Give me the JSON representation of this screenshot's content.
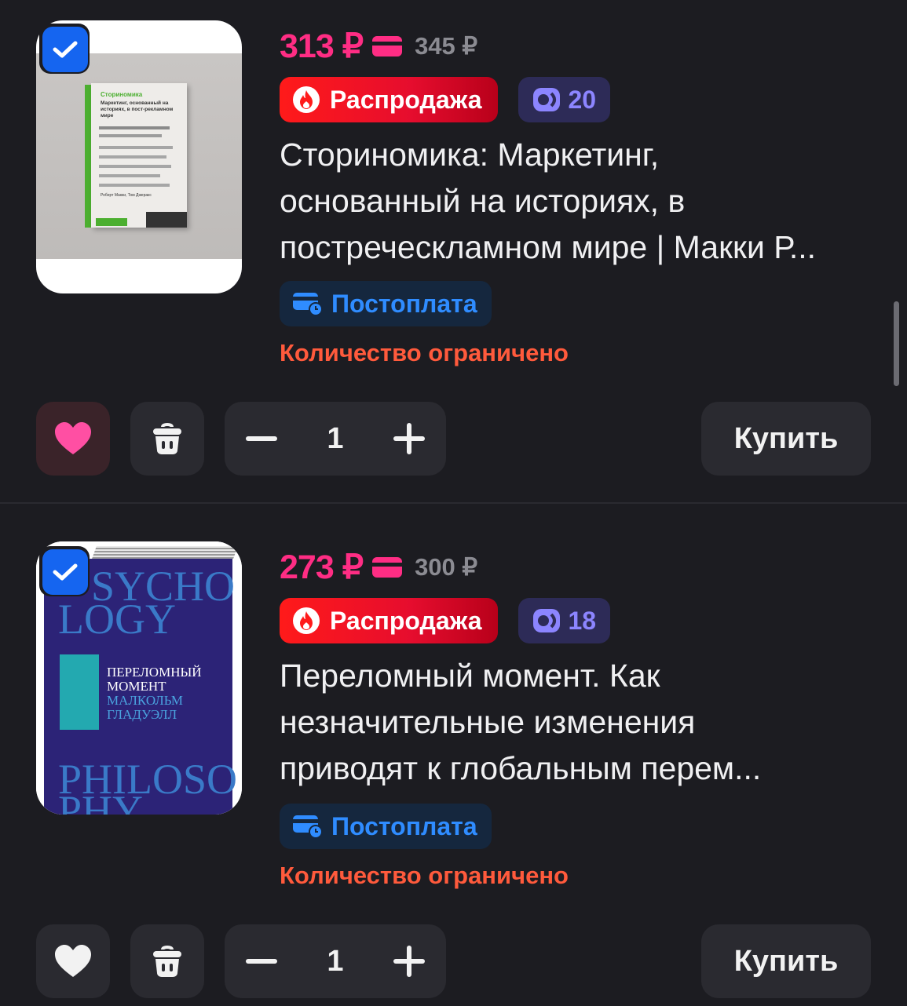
{
  "items": [
    {
      "selected": true,
      "price": "313 ₽",
      "old_price": "345 ₽",
      "sale_label": "Распродажа",
      "points": "20",
      "title_lines": [
        "Сториномика: Маркетинг,",
        "основанный на историях, в",
        "постреческламном мире | Макки Р..."
      ],
      "postpay_label": "Постоплата",
      "limited_label": "Количество ограничено",
      "favorite": true,
      "quantity": "1",
      "buy_label": "Купить",
      "cover": {
        "title": "Сториномика",
        "subtitle": "Маркетинг, основанный на историях, в пост-рекламном мире",
        "authors": "Роберт Макки, Том Джеракс"
      }
    },
    {
      "selected": true,
      "price": "273 ₽",
      "old_price": "300 ₽",
      "sale_label": "Распродажа",
      "points": "18",
      "title_lines": [
        "Переломный момент. Как",
        "незначительные изменения",
        "приводят к глобальным перем..."
      ],
      "postpay_label": "Постоплата",
      "limited_label": "Количество ограничено",
      "favorite": false,
      "quantity": "1",
      "buy_label": "Купить",
      "cover": {
        "word_top_1": "SYCHO",
        "word_top_2": "LOGY",
        "title_1": "ПЕРЕЛОМНЫЙ",
        "title_2": "МОМЕНТ",
        "author_1": "МАЛКОЛЬМ",
        "author_2": "ГЛАДУЭЛЛ",
        "word_bottom_1": "PHILOSO",
        "word_bottom_2": "PHY"
      }
    }
  ],
  "colors": {
    "price": "#ff2d84",
    "sale": "#ff1a1a",
    "points": "#8c85ff",
    "postpay": "#2f8cff",
    "limited": "#ff5a3c",
    "accent_check": "#1565f0",
    "heart_active": "#ff4fa3"
  },
  "icons": [
    "check-icon",
    "card-icon",
    "fire-icon",
    "points-icon",
    "postpay-card-icon",
    "heart-icon",
    "trash-icon",
    "minus-icon",
    "plus-icon"
  ]
}
